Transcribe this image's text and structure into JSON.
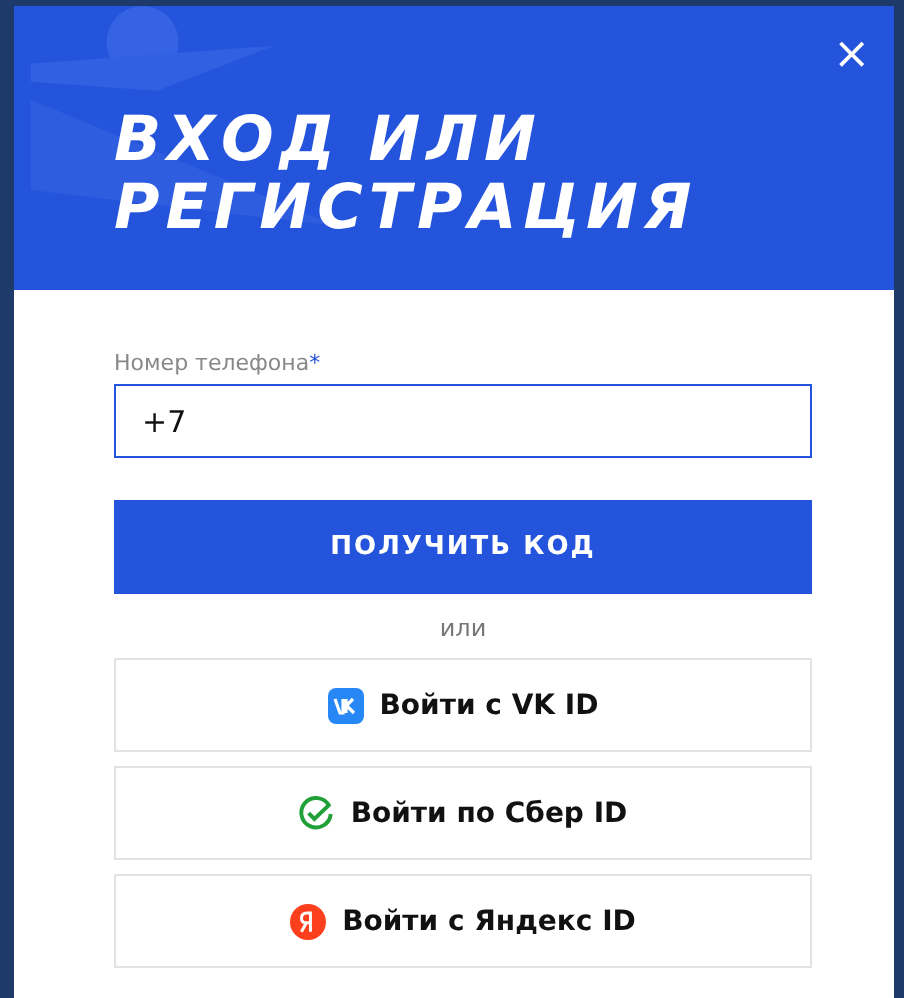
{
  "dialog": {
    "title_lines": [
      "ВХОД ИЛИ",
      "РЕГИСТРАЦИЯ"
    ],
    "close": "×"
  },
  "phone": {
    "label": "Номер телефона",
    "required_mark": "*",
    "value": "+7",
    "focused": true
  },
  "submit": "ПОЛУЧИТЬ КОД",
  "separator": "или",
  "providers": [
    {
      "kind": "vk",
      "label": "Войти с VK ID"
    },
    {
      "kind": "sber",
      "label": "Войти по Сбер ID"
    },
    {
      "kind": "yandex",
      "label": "Войти с Яндекс ID"
    }
  ]
}
